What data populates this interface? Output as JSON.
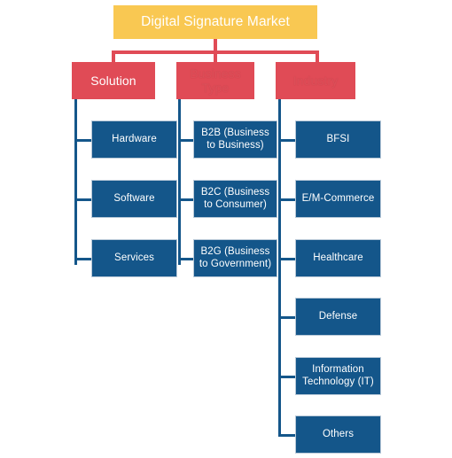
{
  "diagram": {
    "title": "Digital Signature Market",
    "type": "market-segmentation-tree",
    "colors": {
      "root": "#F9C852",
      "level1": "#E04B56",
      "leaf": "#14568A",
      "leaf_border": "#B9C9D8",
      "background": "#FFFFFF"
    },
    "root": {
      "label": "Digital Signature Market"
    },
    "branches": [
      {
        "label": "Solution",
        "label_visible": true,
        "children": [
          {
            "label": "Hardware"
          },
          {
            "label": "Software"
          },
          {
            "label": "Services"
          }
        ]
      },
      {
        "label": "Business Type",
        "label_visible": false,
        "children": [
          {
            "label": "B2B (Business to Business)"
          },
          {
            "label": "B2C (Business to Consumer)"
          },
          {
            "label": "B2G (Business to Government)"
          }
        ]
      },
      {
        "label": "Industry",
        "label_visible": false,
        "children": [
          {
            "label": "BFSI"
          },
          {
            "label": "E/M-Commerce"
          },
          {
            "label": "Healthcare"
          },
          {
            "label": "Defense"
          },
          {
            "label": "Information Technology (IT)"
          },
          {
            "label": "Others"
          }
        ]
      }
    ]
  }
}
